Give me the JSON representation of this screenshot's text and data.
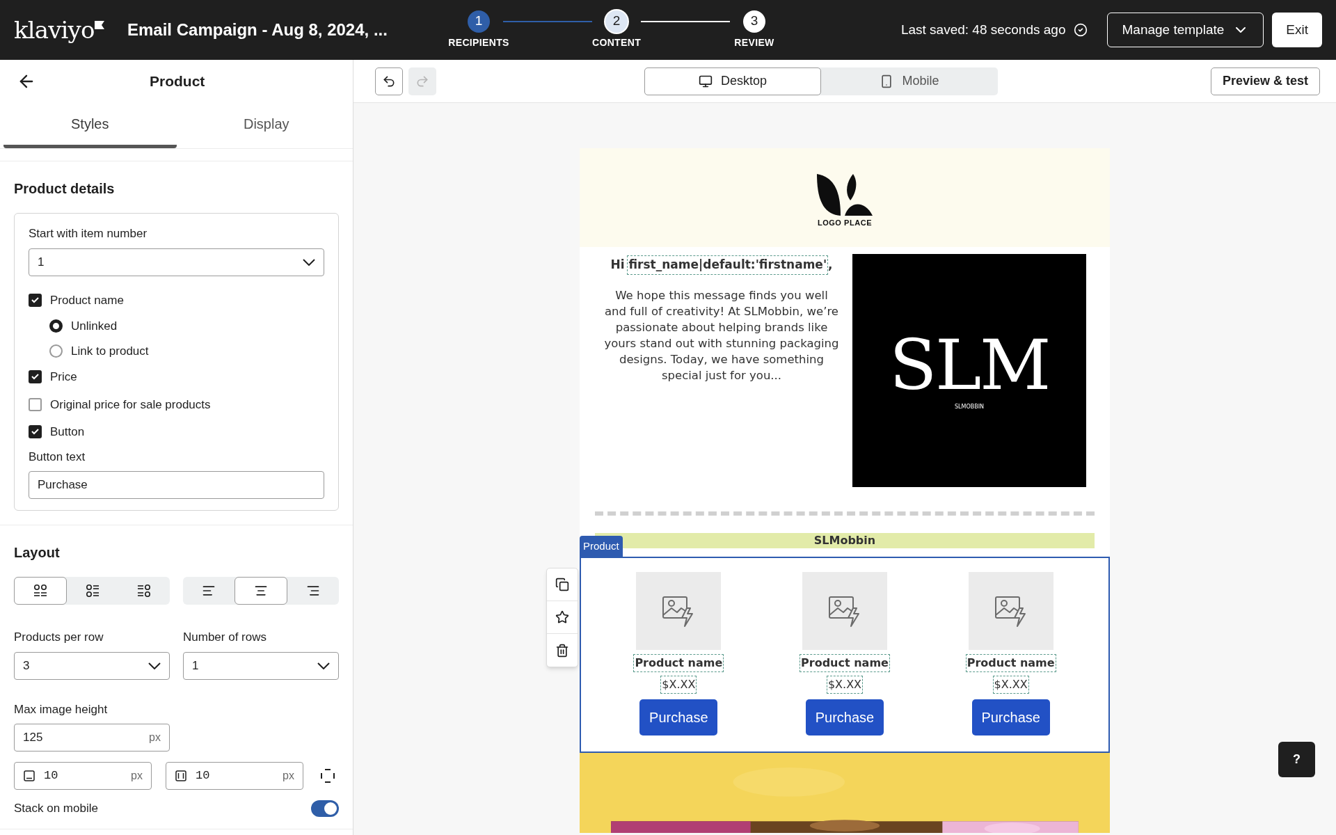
{
  "header": {
    "logo": "klaviyo",
    "title": "Email Campaign - Aug 8, 2024, ...",
    "steps": [
      {
        "number": "1",
        "label": "RECIPIENTS",
        "completed": true,
        "selected": false
      },
      {
        "number": "2",
        "label": "CONTENT",
        "completed": false,
        "selected": true
      },
      {
        "number": "3",
        "label": "REVIEW",
        "completed": false,
        "selected": false
      }
    ],
    "saved": "Last saved: 48 seconds ago",
    "manage": "Manage template",
    "exit": "Exit"
  },
  "panel": {
    "title": "Product",
    "tabs": [
      {
        "label": "Styles",
        "selected": true
      },
      {
        "label": "Display",
        "selected": false
      }
    ],
    "details": {
      "heading": "Product details",
      "start_label": "Start with item number",
      "start_value": "1",
      "options": [
        {
          "kind": "checkbox",
          "label": "Product name",
          "checked": true
        },
        {
          "kind": "radio",
          "label": "Unlinked",
          "checked": true
        },
        {
          "kind": "radio",
          "label": "Link to product",
          "checked": false
        },
        {
          "kind": "checkbox",
          "label": "Price",
          "checked": true
        },
        {
          "kind": "checkbox",
          "label": "Original price for sale products",
          "checked": false
        },
        {
          "kind": "checkbox",
          "label": "Button",
          "checked": true
        }
      ],
      "button_text_label": "Button text",
      "button_text_value": "Purchase"
    },
    "layout": {
      "heading": "Layout",
      "arrangements": [
        {
          "kind": "grid",
          "selected": true
        },
        {
          "kind": "image-left",
          "selected": false
        },
        {
          "kind": "image-right",
          "selected": false
        }
      ],
      "alignments": [
        {
          "kind": "left",
          "selected": false
        },
        {
          "kind": "center",
          "selected": true
        },
        {
          "kind": "right",
          "selected": false
        }
      ],
      "per_row": {
        "label": "Products per row",
        "value": "3"
      },
      "rows": {
        "label": "Number of rows",
        "value": "1"
      },
      "max_height": {
        "label": "Max image height",
        "value": "125",
        "unit": "px"
      },
      "spacing": [
        {
          "kind": "vertical",
          "value": "10",
          "unit": "px"
        },
        {
          "kind": "horizontal",
          "value": "10",
          "unit": "px"
        }
      ],
      "stack": {
        "label": "Stack on mobile",
        "on": true
      }
    }
  },
  "toolbar": {
    "history": [
      {
        "kind": "undo",
        "disabled": false
      },
      {
        "kind": "redo",
        "disabled": true
      }
    ],
    "views": [
      {
        "kind": "desktop",
        "label": "Desktop",
        "selected": true
      },
      {
        "kind": "mobile",
        "label": "Mobile",
        "selected": false
      }
    ],
    "preview": "Preview & test"
  },
  "email": {
    "logo_text": "LOGO PLACE",
    "greeting_prefix": "Hi",
    "greeting_tag": "first_name|default:'firstname'",
    "greeting_suffix": ",",
    "body": "We hope this message finds you well and full of creativity! At SLMobbin, we’re passionate about helping brands like yours stand out with stunning packaging designs. Today, we have something special just for you...",
    "brand_title": "SLM",
    "brand_subtitle": "SLMOBBIN",
    "banner": "SLMobbin",
    "block_label": "Product",
    "products": [
      {
        "name": "Product name",
        "price": "$X.XX",
        "button": "Purchase"
      },
      {
        "name": "Product name",
        "price": "$X.XX",
        "button": "Purchase"
      },
      {
        "name": "Product name",
        "price": "$X.XX",
        "button": "Purchase"
      }
    ]
  },
  "help": "?"
}
